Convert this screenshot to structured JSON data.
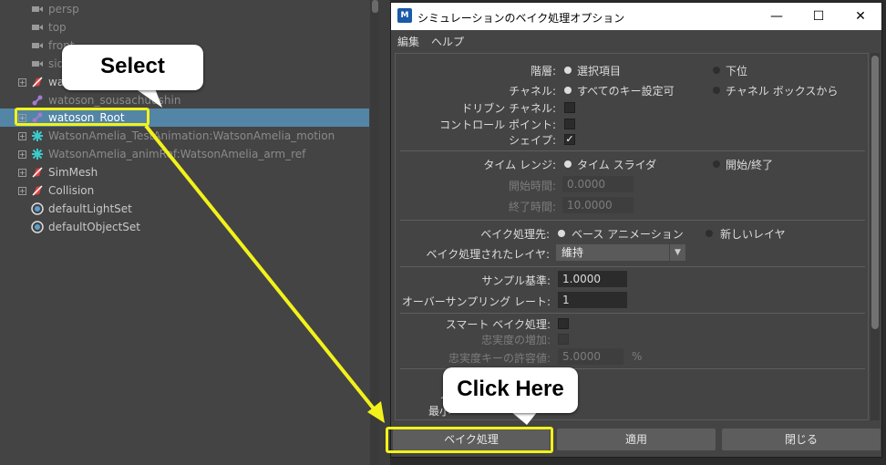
{
  "outliner": {
    "rows": [
      {
        "label": "persp",
        "icon": "camera-icon",
        "dim": true
      },
      {
        "label": "top",
        "icon": "camera-icon",
        "dim": true
      },
      {
        "label": "front",
        "icon": "camera-icon",
        "dim": true
      },
      {
        "label": "side",
        "icon": "camera-icon",
        "dim": true
      },
      {
        "label": "wa",
        "icon": "mesh-transform-icon",
        "dim": false
      },
      {
        "label": "watoson_sousachuushin",
        "icon": "joint-icon",
        "dim": true
      },
      {
        "label": "watoson_Root",
        "icon": "joint-icon",
        "dim": false
      },
      {
        "label": "WatsonAmelia_TestAnimation:WatsonAmelia_motion",
        "icon": "character-icon",
        "dim": true
      },
      {
        "label": "WatsonAmelia_animRef:WatsonAmelia_arm_ref",
        "icon": "character-icon",
        "dim": true
      },
      {
        "label": "SimMesh",
        "icon": "mesh-transform-icon",
        "dim": false
      },
      {
        "label": "Collision",
        "icon": "mesh-transform-icon",
        "dim": false
      },
      {
        "label": "defaultLightSet",
        "icon": "set-icon",
        "dim": false
      },
      {
        "label": "defaultObjectSet",
        "icon": "set-icon",
        "dim": false
      }
    ]
  },
  "dialog": {
    "app_icon": "M",
    "title": "シミュレーションのベイク処理オプション",
    "controls": {
      "minimize": "—",
      "maximize": "☐",
      "close": "✕"
    },
    "menu": [
      "編集",
      "ヘルプ"
    ],
    "hierarchy": {
      "label": "階層:",
      "opt1": "選択項目",
      "opt2": "下位"
    },
    "channels": {
      "label": "チャネル:",
      "opt1": "すべてのキー設定可",
      "opt2": "チャネル ボックスから"
    },
    "driven_channels": {
      "label": "ドリブン チャネル:"
    },
    "control_points": {
      "label": "コントロール ポイント:"
    },
    "shapes": {
      "label": "シェイプ:",
      "check": "✓"
    },
    "time_range": {
      "label": "タイム レンジ:",
      "opt1": "タイム スライダ",
      "opt2": "開始/終了"
    },
    "start_time": {
      "label": "開始時間:",
      "value": "0.0000"
    },
    "end_time": {
      "label": "終了時間:",
      "value": "10.0000"
    },
    "bake_to": {
      "label": "ベイク処理先:",
      "opt1": "ベース アニメーション",
      "opt2": "新しいレイヤ"
    },
    "baked_layers": {
      "label": "ベイク処理されたレイヤ:",
      "value": "維持",
      "arrow": "▼"
    },
    "sample_by": {
      "label": "サンプル基準:",
      "value": "1.0000"
    },
    "oversampling": {
      "label": "オーバーサンプリング レート:",
      "value": "1"
    },
    "smart_bake": {
      "label": "スマート ベイク処理:"
    },
    "increase_fidelity": {
      "label": "忠実度の増加:"
    },
    "fidelity_tolerance": {
      "label": "忠実度キーの許容値:",
      "value": "5.0000",
      "unit": "%"
    },
    "partial_1": "ノ",
    "partial_2": "最小",
    "buttons": {
      "bake": "ベイク処理",
      "apply": "適用",
      "close": "閉じる"
    }
  },
  "callouts": {
    "select": "Select",
    "click_here": "Click Here"
  },
  "colors": {
    "highlight": "#f2f21a",
    "selection": "#5285a6"
  }
}
